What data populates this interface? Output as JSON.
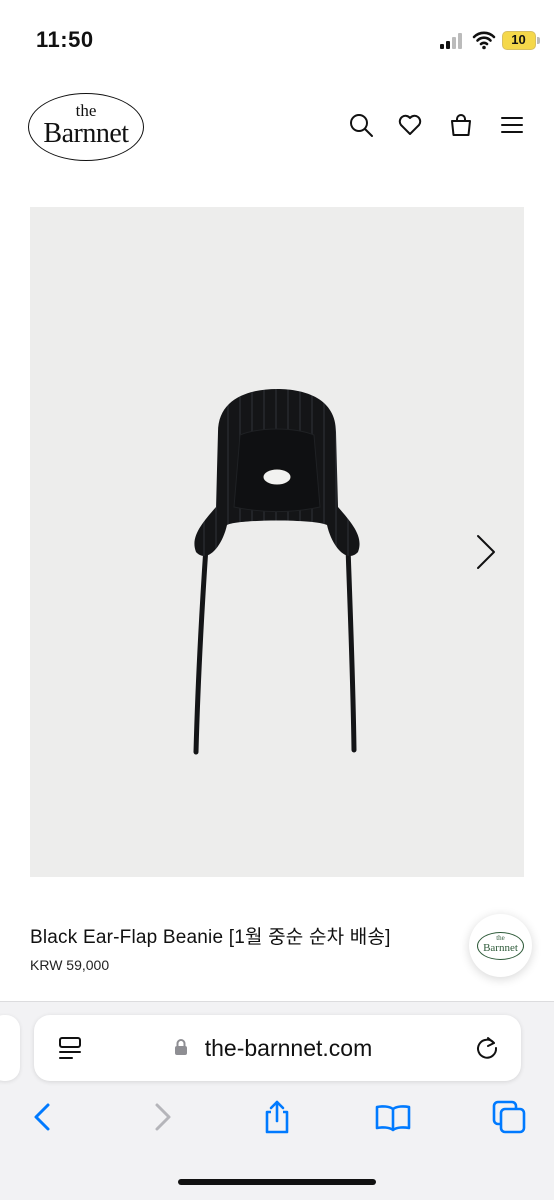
{
  "status_bar": {
    "time": "11:50",
    "battery": "10"
  },
  "header": {
    "logo_small": "the",
    "logo_name": "Barnnet",
    "icons": [
      "search-icon",
      "heart-icon",
      "bag-icon",
      "menu-icon"
    ]
  },
  "product": {
    "title": "Black Ear-Flap Beanie [1월 중순 순차 배송]",
    "price": "KRW 59,000",
    "patch_small": "the",
    "patch_name": "Barnnet"
  },
  "chat_widget": {
    "logo_small": "the",
    "logo_name": "Barnnet"
  },
  "browser": {
    "url": "the-barnnet.com",
    "toolbar": [
      "back-icon",
      "forward-icon",
      "share-icon",
      "bookmarks-icon",
      "tabs-icon"
    ]
  },
  "colors": {
    "accent": "#007aff",
    "brand_green": "#2f5b3a",
    "image_bg": "#ededec"
  }
}
